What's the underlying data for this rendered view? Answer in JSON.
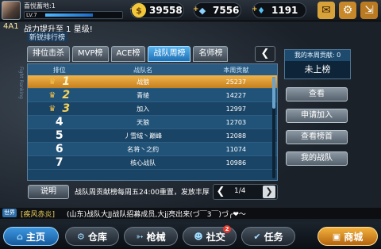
{
  "topbar": {
    "player_name": "喜悦蓄地:1",
    "level": "LV.7",
    "currencies": [
      {
        "icon": "gold-coin-icon",
        "symbol": "$",
        "value": "39558",
        "color": "#f2c83a"
      },
      {
        "icon": "crystal-icon",
        "symbol": "◆",
        "value": "7556",
        "color": "#8fd2ff"
      },
      {
        "icon": "diamond-icon",
        "symbol": "♦",
        "value": "1191",
        "color": "#57c3f5"
      }
    ],
    "mail_icon": "mail-icon",
    "settings_icon": "gear-icon",
    "exit_icon": "exit-icon"
  },
  "notice": {
    "tag": "4A1",
    "text": "战力提升至 1 星级!"
  },
  "panel": {
    "title": "新锐排行榜",
    "side_label": "Fight Ranking",
    "tabs": [
      {
        "label": "排位击杀",
        "active": false
      },
      {
        "label": "MVP榜",
        "active": false
      },
      {
        "label": "ACE榜",
        "active": false
      },
      {
        "label": "战队周榜",
        "active": true
      },
      {
        "label": "名师榜",
        "active": false
      }
    ],
    "tab_arrow": "❮",
    "table": {
      "headers": [
        "排位",
        "战队名",
        "本周贡献"
      ],
      "rows": [
        {
          "rank": "1",
          "name": "战狼",
          "score": "25237",
          "crown": true,
          "selected": true
        },
        {
          "rank": "2",
          "name": "青绫",
          "score": "14227",
          "crown": true,
          "selected": false
        },
        {
          "rank": "3",
          "name": "加入",
          "score": "12997",
          "crown": true,
          "selected": false
        },
        {
          "rank": "4",
          "name": "天狼",
          "score": "12703",
          "crown": false,
          "selected": false
        },
        {
          "rank": "5",
          "name": "丿雪绒丶巅峰",
          "score": "12088",
          "crown": false,
          "selected": false
        },
        {
          "rank": "6",
          "name": "名将丶之约",
          "score": "11074",
          "crown": false,
          "selected": false
        },
        {
          "rank": "7",
          "name": "核心战队",
          "score": "10986",
          "crown": false,
          "selected": false
        }
      ]
    },
    "explain_button": "说明",
    "explain_text": "战队周贡献榜每周五24:00重置，发放丰厚",
    "pager": {
      "prev": "❮",
      "text": "1/4",
      "next": "❯"
    }
  },
  "right_panel": {
    "title": "我的本周贡献: 0",
    "value": "未上榜",
    "buttons": [
      "查看",
      "申请加入",
      "查看榜首",
      "我的战队"
    ]
  },
  "chat": {
    "tag": "世界",
    "name": "[疾风赤炎]",
    "message": "(山东)战队大JJ战队招募成员,大jj亮出来(づ￣3￣)づ╭❤～"
  },
  "bottom_nav": [
    {
      "label": "主页",
      "icon": "home-icon",
      "glyph": "⌂",
      "kind": "home"
    },
    {
      "label": "仓库",
      "icon": "warehouse-icon",
      "glyph": "⚙",
      "kind": "normal"
    },
    {
      "label": "枪械",
      "icon": "gun-icon",
      "glyph": "➳",
      "kind": "normal"
    },
    {
      "label": "社交",
      "icon": "social-icon",
      "glyph": "☻",
      "kind": "normal",
      "badge": "2"
    },
    {
      "label": "任务",
      "icon": "task-icon",
      "glyph": "✔",
      "kind": "normal"
    },
    {
      "label": "商城",
      "icon": "shop-icon",
      "glyph": "▣",
      "kind": "shop"
    }
  ]
}
